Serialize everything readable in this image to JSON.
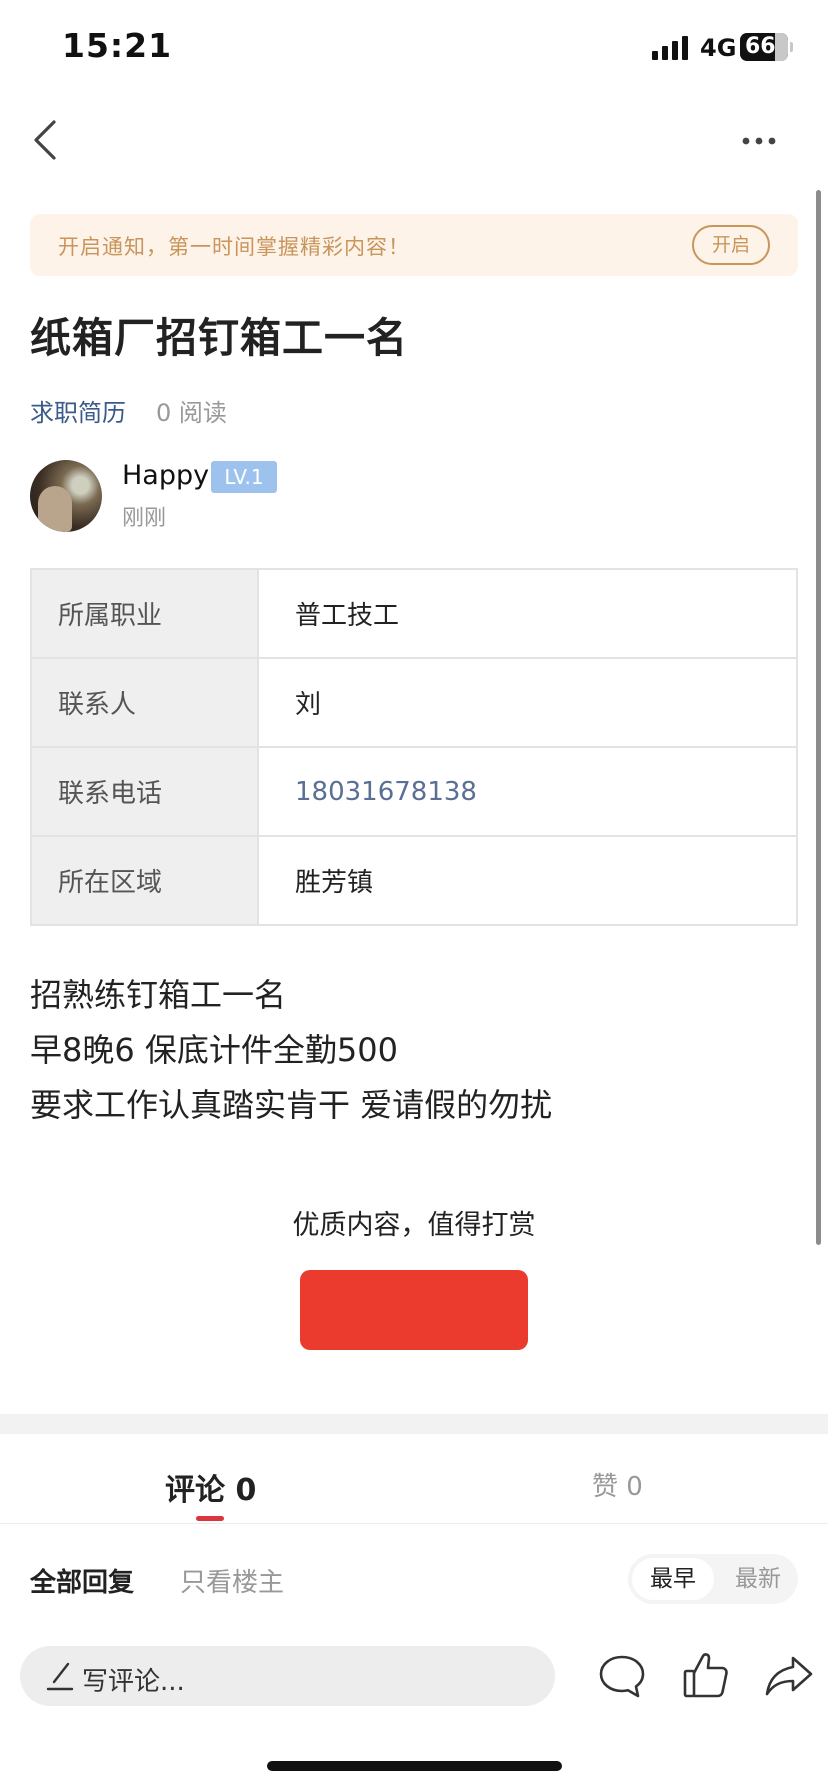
{
  "status_bar": {
    "time": "15:21",
    "network": "4G",
    "battery": "66"
  },
  "nav": {
    "back_icon": "chevron-left-icon",
    "more_icon": "more-dots-icon"
  },
  "banner": {
    "text": "开启通知，第一时间掌握精彩内容！",
    "button_label": "开启",
    "color": "#c9955a",
    "background": "#fdf3e9"
  },
  "post": {
    "title": "纸箱厂招钉箱工一名",
    "category": "求职简历",
    "reads": "0 阅读",
    "author": {
      "name": "Happy",
      "level": "LV.1",
      "time": "刚刚"
    },
    "info": [
      {
        "label": "所属职业",
        "value": "普工技工"
      },
      {
        "label": "联系人",
        "value": "刘"
      },
      {
        "label": "联系电话",
        "value": "18031678138"
      },
      {
        "label": "所在区域",
        "value": "胜芳镇"
      }
    ],
    "body_lines": [
      "招熟练钉箱工一名",
      "早8晚6 保底计件全勤500",
      "要求工作认真踏实肯干 爱请假的勿扰"
    ]
  },
  "tip": {
    "text": "优质内容，值得打赏",
    "button_color": "#ea3b2e"
  },
  "tabs": {
    "comments": "评论 0",
    "likes": "赞 0",
    "accent": "#d9363e"
  },
  "filters": {
    "all": "全部回复",
    "owner_only": "只看楼主",
    "sort_earliest": "最早",
    "sort_latest": "最新"
  },
  "bottom_bar": {
    "placeholder": "写评论...",
    "icons": [
      "pen-icon",
      "comment-icon",
      "thumbs-up-icon",
      "share-icon"
    ]
  }
}
